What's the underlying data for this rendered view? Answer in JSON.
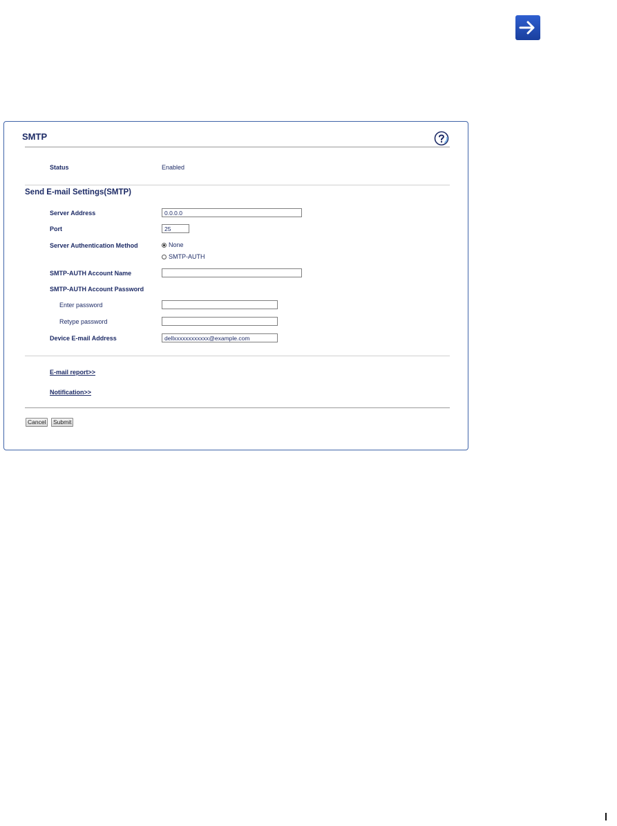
{
  "header": {
    "title": "SMTP"
  },
  "status": {
    "label": "Status",
    "value": "Enabled"
  },
  "send_settings": {
    "section_title": "Send E-mail Settings(SMTP)",
    "server_address": {
      "label": "Server Address",
      "value": "0.0.0.0"
    },
    "port": {
      "label": "Port",
      "value": "25"
    },
    "auth_method": {
      "label": "Server Authentication Method",
      "options": [
        "None",
        "SMTP-AUTH"
      ],
      "selected": "None"
    },
    "account_name": {
      "label": "SMTP-AUTH Account Name",
      "value": ""
    },
    "account_password": {
      "label": "SMTP-AUTH Account Password",
      "enter_label": "Enter password",
      "retype_label": "Retype password"
    },
    "device_email": {
      "label": "Device E-mail Address",
      "value": "dellxxxxxxxxxxxx@example.com"
    }
  },
  "links": {
    "email_report": "E-mail report>>",
    "notification": "Notification>>"
  },
  "buttons": {
    "cancel": "Cancel",
    "submit": "Submit"
  },
  "colors": {
    "text": "#1d2b66",
    "panel_border": "#3f63a8",
    "nav_arrow": "#2f5fd0"
  },
  "icons": {
    "nav": "arrow-right-icon",
    "help": "help-icon"
  }
}
